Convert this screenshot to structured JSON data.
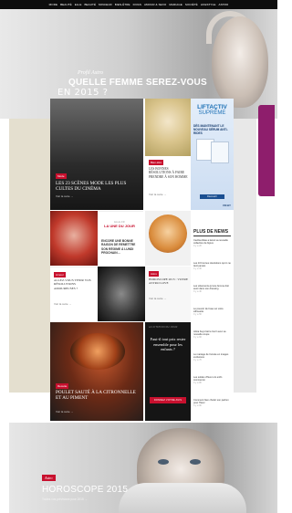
{
  "topnav": {
    "items": [
      "MODE",
      "BEAUTÉ",
      "ELLE",
      "BEAUTÉ",
      "MINCEUR",
      "BIEN-ÊTRE",
      "DIVAS",
      "AMOUR & SEXO",
      "MARIAGE",
      "SOCIÉTÉ",
      "LIFESTYLE",
      "ASTRO"
    ]
  },
  "hero": {
    "profil": "Profil Astro",
    "title": "QUELLE FEMME SEREZ-VOUS",
    "subtitle": "EN 2015 ?"
  },
  "tiles": {
    "cinema": {
      "tag": "Mode",
      "title": "Les 23 scènes mode les plus cultes du cinéma",
      "more": "Voir la suite →"
    },
    "resolutions": {
      "tag": "Bien-être",
      "title": "Les bonnes résolutions à faire prendre à son homme",
      "more": "Voir la suite →"
    },
    "ad": {
      "brand": "LIFTACTIV",
      "brand2": "SUPRÊME",
      "dispo": "DÈS MAINTENANT LE NOUVEAU SÉRUM ANTI-RIDES",
      "button": "Découvrir",
      "vichy": "VICHY"
    },
    "une": {
      "kicker": "ELLE.FR",
      "label": "LA UNE DU JOUR",
      "title": "Encore une bonne raison de remettre son régime à lundi prochain…"
    },
    "amour": {
      "tag": "Amour",
      "title": "Allez-vous tenir vos résolutions amoureuses ?",
      "more": "Voir la suite →"
    },
    "horoscope": {
      "tag": "Astro",
      "title": "Horoscope 2015 : votre astro love",
      "more": "Voir la suite →"
    },
    "poulet": {
      "tag": "Recette",
      "title": "Poulet sauté à la citronnelle et au piment",
      "more": "Voir la suite →"
    },
    "citation": {
      "label": "LA CITATION DU JOUR",
      "quote": "Faut-il tout prix rester ensemble pour les enfants ?",
      "cta": "DONNEZ VOTRE AVIS"
    }
  },
  "news": {
    "heading": "PLUS DE NEWS",
    "items": [
      {
        "text": "Cecilia Attias a lancé sa nouvelle collection de bijoux",
        "meta": "Il y a 2h"
      },
      {
        "text": "Les 10 bonnes résolutions qu'on ne tient jamais",
        "meta": "Il y a 3h"
      },
      {
        "text": "Les vêtements qu'une femme doit avoir dans son dressing",
        "meta": "Il y a 4h"
      },
      {
        "text": "Le pouvoir de l'eau sur votre silhouette",
        "meta": "Il y a 5h"
      },
      {
        "text": "Alicia Keys fait le buzz avec sa nouvelle coupe",
        "meta": "Il y a 6h"
      },
      {
        "text": "Le mariage de l'année en images exclusives",
        "meta": "Il y a 7h"
      },
      {
        "text": "Les soldes d'hiver ont enfin commencé",
        "meta": "Il y a 8h"
      },
      {
        "text": "Comment bien choisir son parfum pour l'hiver",
        "meta": "Il y a 9h"
      }
    ]
  },
  "bottom": {
    "tag": "Astro",
    "title": "HOROSCOPE 2015",
    "sub": "Toutes vos prévisions pour 2015 →"
  }
}
